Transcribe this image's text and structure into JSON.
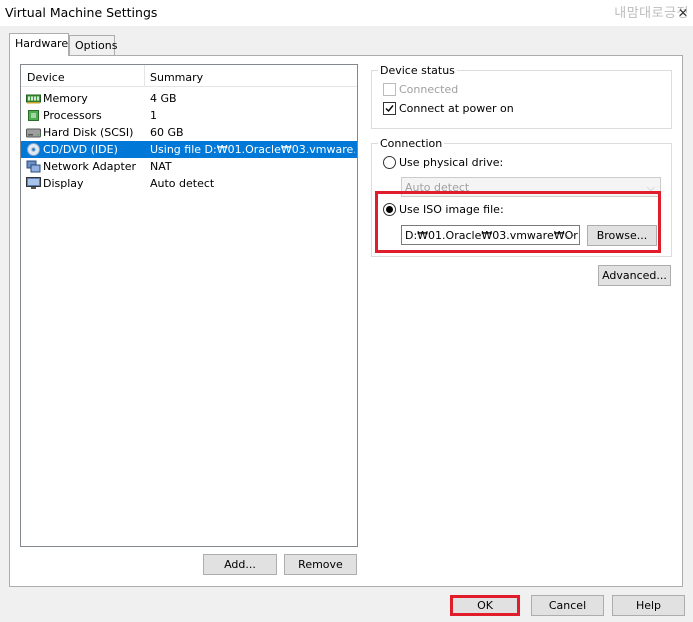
{
  "window": {
    "title": "Virtual Machine Settings",
    "watermark": "내맘대로긍정",
    "close_symbol": "✕"
  },
  "tabs": [
    {
      "label": "Hardware",
      "active": true
    },
    {
      "label": "Options",
      "active": false
    }
  ],
  "device_list": {
    "headers": {
      "device": "Device",
      "summary": "Summary"
    },
    "rows": [
      {
        "device": "Memory",
        "summary": "4 GB",
        "icon": "memory-icon"
      },
      {
        "device": "Processors",
        "summary": "1",
        "icon": "processor-icon"
      },
      {
        "device": "Hard Disk (SCSI)",
        "summary": "60 GB",
        "icon": "hard-disk-icon"
      },
      {
        "device": "CD/DVD (IDE)",
        "summary": "Using file D:₩01.Oracle₩03.vmware…",
        "icon": "cd-dvd-icon",
        "selected": true
      },
      {
        "device": "Network Adapter",
        "summary": "NAT",
        "icon": "network-adapter-icon"
      },
      {
        "device": "Display",
        "summary": "Auto detect",
        "icon": "display-icon"
      }
    ]
  },
  "list_buttons": {
    "add": "Add...",
    "remove": "Remove"
  },
  "device_status": {
    "legend": "Device status",
    "connected": {
      "label": "Connected",
      "checked": false,
      "disabled": true
    },
    "connect_at_power_on": {
      "label": "Connect at power on",
      "checked": true
    }
  },
  "connection": {
    "legend": "Connection",
    "physical_drive": {
      "label": "Use physical drive:",
      "selected": false,
      "value": "Auto detect"
    },
    "iso_image": {
      "label": "Use ISO image file:",
      "selected": true,
      "value": "D:₩01.Oracle₩03.vmware₩Or"
    },
    "browse": "Browse..."
  },
  "advanced": "Advanced...",
  "footer": {
    "ok": "OK",
    "cancel": "Cancel",
    "help": "Help"
  },
  "colors": {
    "selection": "#0078d7",
    "highlight": "#e11d2b"
  }
}
